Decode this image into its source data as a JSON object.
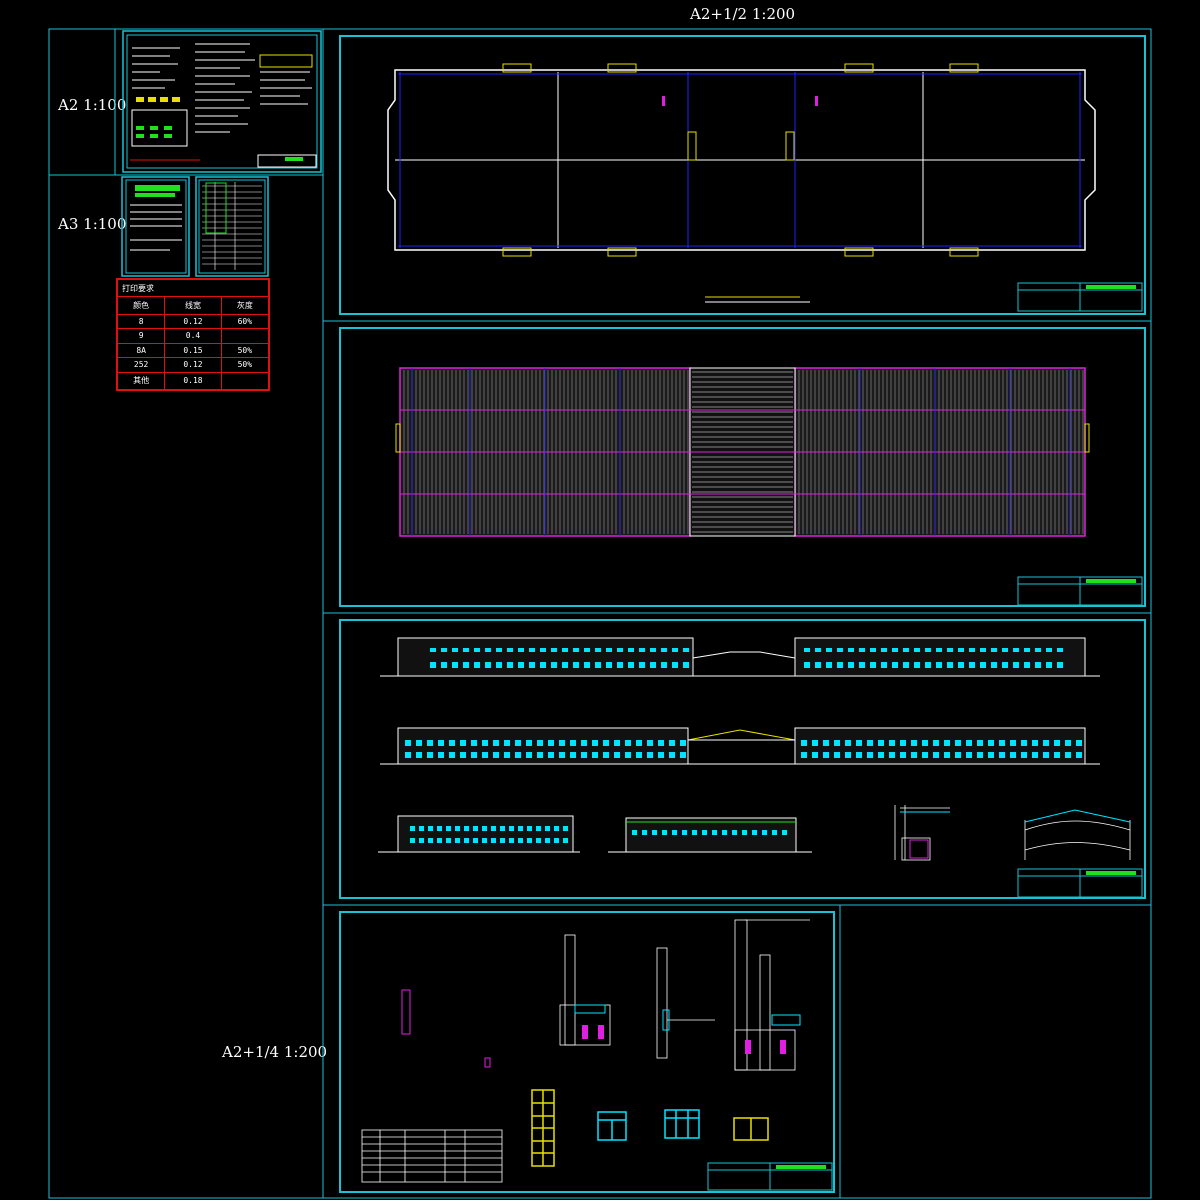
{
  "labels": {
    "top_scale": "A2+1/2  1:200",
    "a2_scale": "A2 1:100",
    "a3_scale": "A3 1:100",
    "a2q_scale": "A2+1/4  1:200"
  },
  "print_table": {
    "title": "打印要求",
    "headers": [
      "颜色",
      "线宽",
      "灰度"
    ],
    "rows": [
      [
        "8",
        "0.12",
        "60%"
      ],
      [
        "9",
        "0.4",
        ""
      ],
      [
        "8A",
        "0.15",
        "50%"
      ],
      [
        "252",
        "0.12",
        "50%"
      ],
      [
        "其他",
        "0.18",
        ""
      ]
    ]
  },
  "colors": {
    "background": "#000000",
    "frame": "#19c3d6",
    "print_table_border": "#e01010",
    "wall": "#ffffff",
    "column_blue": "#2020ff",
    "roof_magenta": "#e020e0",
    "window_cyan": "#00e5ff",
    "yellow": "#e8e000",
    "green": "#20e020"
  }
}
